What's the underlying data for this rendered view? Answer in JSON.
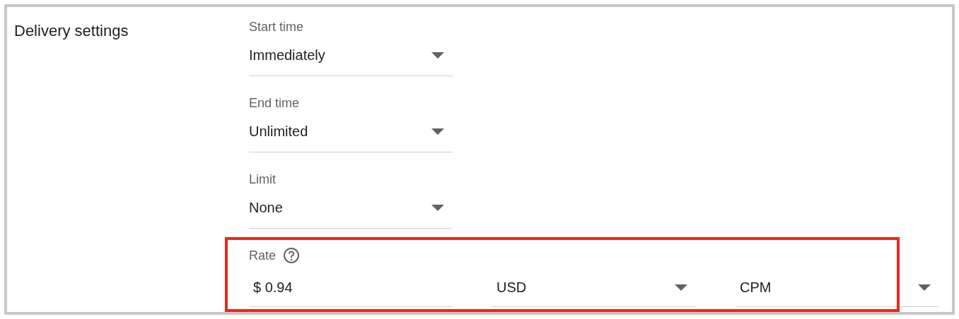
{
  "section": {
    "title": "Delivery settings"
  },
  "fields": [
    {
      "label": "Start time",
      "value": "Immediately",
      "kind": "dropdown"
    },
    {
      "label": "End time",
      "value": "Unlimited",
      "kind": "dropdown"
    },
    {
      "label": "Limit",
      "value": "None",
      "kind": "dropdown"
    }
  ],
  "rate": {
    "label": "Rate",
    "help": true,
    "highlighted": true,
    "amount": "$ 0.94",
    "currency": "USD",
    "type": "CPM"
  }
}
